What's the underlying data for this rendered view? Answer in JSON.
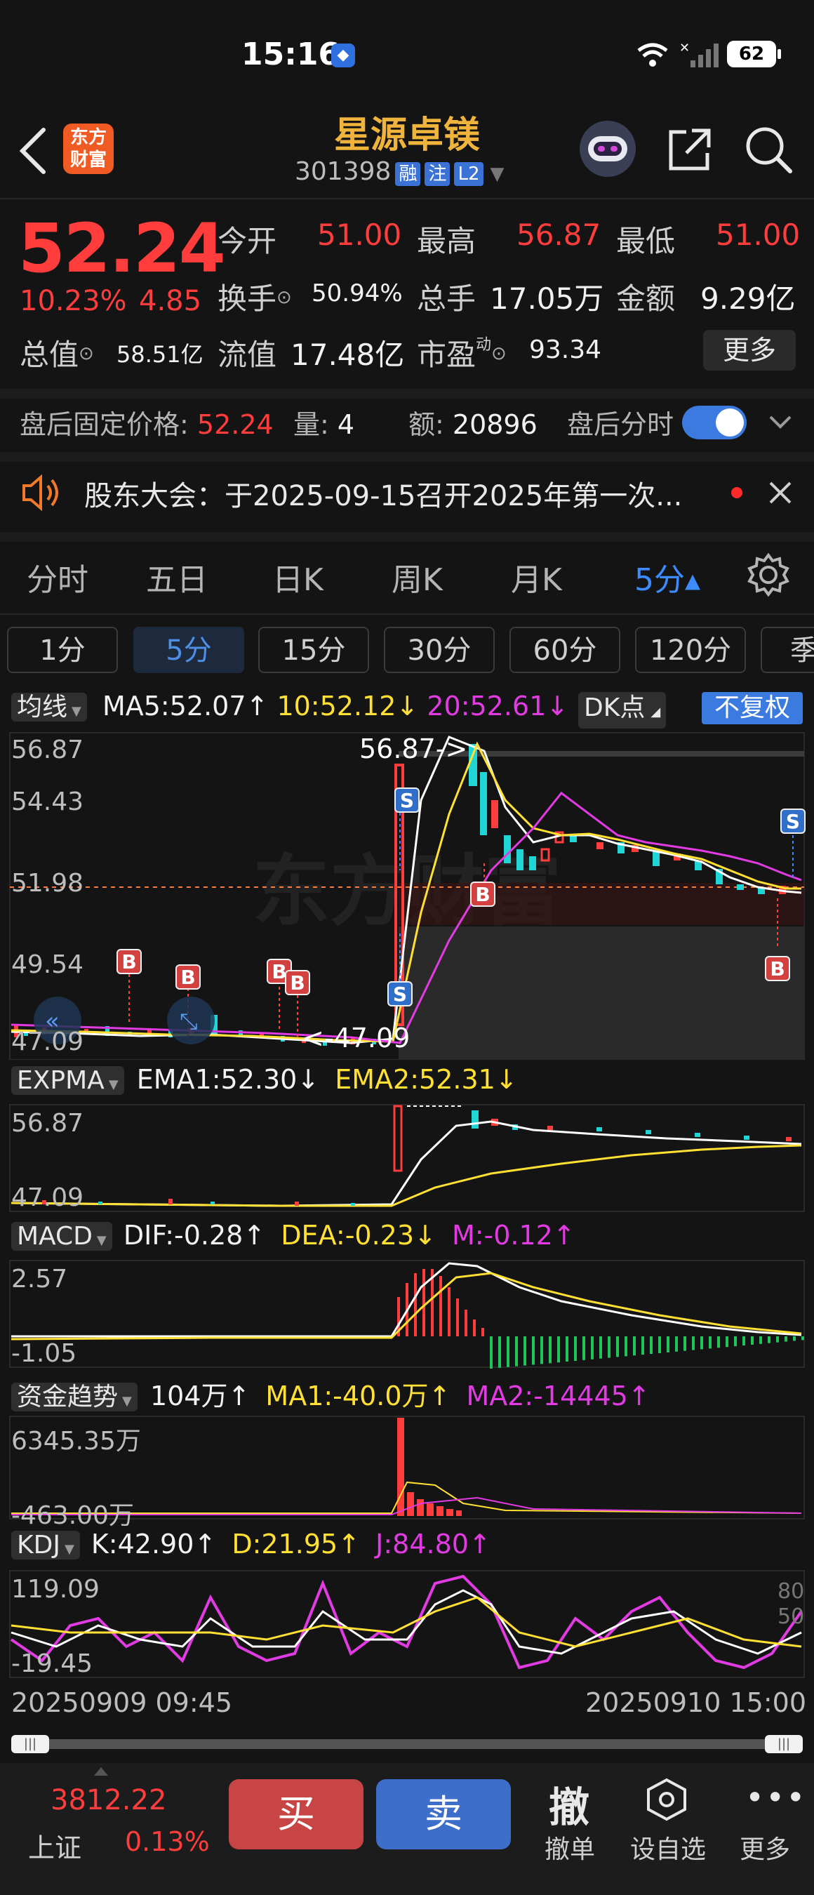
{
  "status_bar": {
    "time": "15:16",
    "battery": "62"
  },
  "header": {
    "logo_line1": "东方",
    "logo_line2": "财富",
    "stock_name": "星源卓镁",
    "stock_code": "301398",
    "tags": [
      "融",
      "注",
      "L2"
    ]
  },
  "quote": {
    "price": "52.24",
    "change_pct": "10.23%",
    "change": "4.85",
    "open_label": "今开",
    "open": "51.00",
    "high_label": "最高",
    "high": "56.87",
    "low_label": "最低",
    "low": "51.00",
    "turnover_label": "换手",
    "turnover": "50.94%",
    "volume_label": "总手",
    "volume": "17.05万",
    "amount_label": "金额",
    "amount": "9.29亿",
    "mktcap_label": "总值",
    "mktcap": "58.51亿",
    "float_label": "流值",
    "float": "17.48亿",
    "pe_label": "市盈",
    "pe_sup": "动",
    "pe": "93.34",
    "more_label": "更多"
  },
  "after_hours": {
    "price_label": "盘后固定价格:",
    "price": "52.24",
    "vol_label": "量:",
    "vol": "4",
    "amt_label": "额:",
    "amt": "20896",
    "toggle_label": "盘后分时"
  },
  "notice": {
    "text": "股东大会：于2025-09-15召开2025年第一次..."
  },
  "chart_tabs": [
    "分时",
    "五日",
    "日K",
    "周K",
    "月K",
    "5分▴"
  ],
  "periods": [
    "1分",
    "5分",
    "15分",
    "30分",
    "60分",
    "120分",
    "季"
  ],
  "ma_bar": {
    "selector": "均线",
    "ma5": "MA5:52.07↑",
    "ma10": "10:52.12↓",
    "ma20": "20:52.61↓",
    "dk": "DK点",
    "fq": "不复权"
  },
  "expma_bar": {
    "selector": "EXPMA",
    "ema1": "EMA1:52.30↓",
    "ema2": "EMA2:52.31↓"
  },
  "macd_bar": {
    "selector": "MACD",
    "dif": "DIF:-0.28↑",
    "dea": "DEA:-0.23↓",
    "m": "M:-0.12↑"
  },
  "fund_bar": {
    "selector": "资金趋势",
    "val": "104万↑",
    "ma1": "MA1:-40.0万↑",
    "ma2": "MA2:-14445↑"
  },
  "kdj_bar": {
    "selector": "KDJ",
    "k": "K:42.90↑",
    "d": "D:21.95↑",
    "j": "J:84.80↑"
  },
  "axes": {
    "main_ticks": [
      "56.87",
      "54.43",
      "51.98",
      "49.54",
      "47.09"
    ],
    "main_high_ann": "56.87->",
    "main_low_ann": "<-47.09",
    "expma_ticks": [
      "56.87",
      "47.09"
    ],
    "macd_ticks": [
      "2.57",
      "-1.05"
    ],
    "fund_ticks": [
      "6345.35万",
      "-463.00万"
    ],
    "kdj_ticks": [
      "119.09",
      "-19.45"
    ],
    "kdj_right": [
      "80",
      "50"
    ],
    "date_start": "20250909 09:45",
    "date_end": "20250910 15:00"
  },
  "trade_markers": [
    "B",
    "B",
    "B",
    "B",
    "S",
    "S",
    "B",
    "S",
    "B"
  ],
  "bottom": {
    "index_value": "3812.22",
    "index_name": "上证",
    "index_pct": "0.13%",
    "buy": "买",
    "sell": "卖",
    "cancel_icon": "撤",
    "cancel": "撤单",
    "watch": "设自选",
    "more": "更多"
  },
  "colors": {
    "up": "#ff3d3d",
    "accent": "#f0b43c",
    "blue": "#3b72d6",
    "bg": "#141414"
  }
}
